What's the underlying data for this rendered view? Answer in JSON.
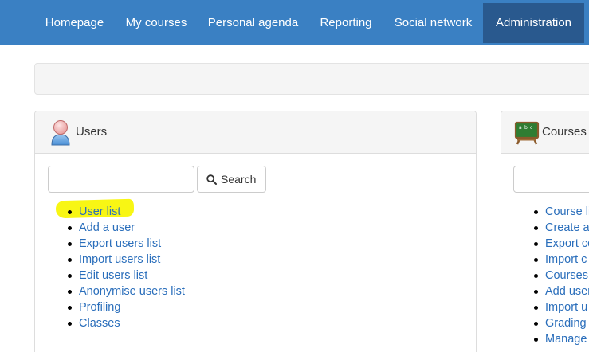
{
  "nav": {
    "items": [
      {
        "label": "Homepage"
      },
      {
        "label": "My courses"
      },
      {
        "label": "Personal agenda"
      },
      {
        "label": "Reporting"
      },
      {
        "label": "Social network"
      },
      {
        "label": "Administration"
      }
    ],
    "active": "Administration"
  },
  "users_panel": {
    "title": "Users",
    "search_value": "",
    "search_button": "Search",
    "links": [
      {
        "label": "User list"
      },
      {
        "label": "Add a user"
      },
      {
        "label": "Export users list"
      },
      {
        "label": "Import users list"
      },
      {
        "label": "Edit users list"
      },
      {
        "label": "Anonymise users list"
      },
      {
        "label": "Profiling"
      },
      {
        "label": "Classes"
      }
    ]
  },
  "courses_panel": {
    "title": "Courses",
    "search_value": "",
    "links": [
      {
        "label": "Course li"
      },
      {
        "label": "Create a"
      },
      {
        "label": "Export co"
      },
      {
        "label": "Import c"
      },
      {
        "label": "Courses"
      },
      {
        "label": "Add user"
      },
      {
        "label": "Import u"
      },
      {
        "label": "Grading"
      },
      {
        "label": "Manage"
      }
    ]
  },
  "colors": {
    "navbar": "#3a80c3",
    "nav_active": "#29598e",
    "link": "#2a6ebb",
    "highlight": "#f7f500"
  }
}
